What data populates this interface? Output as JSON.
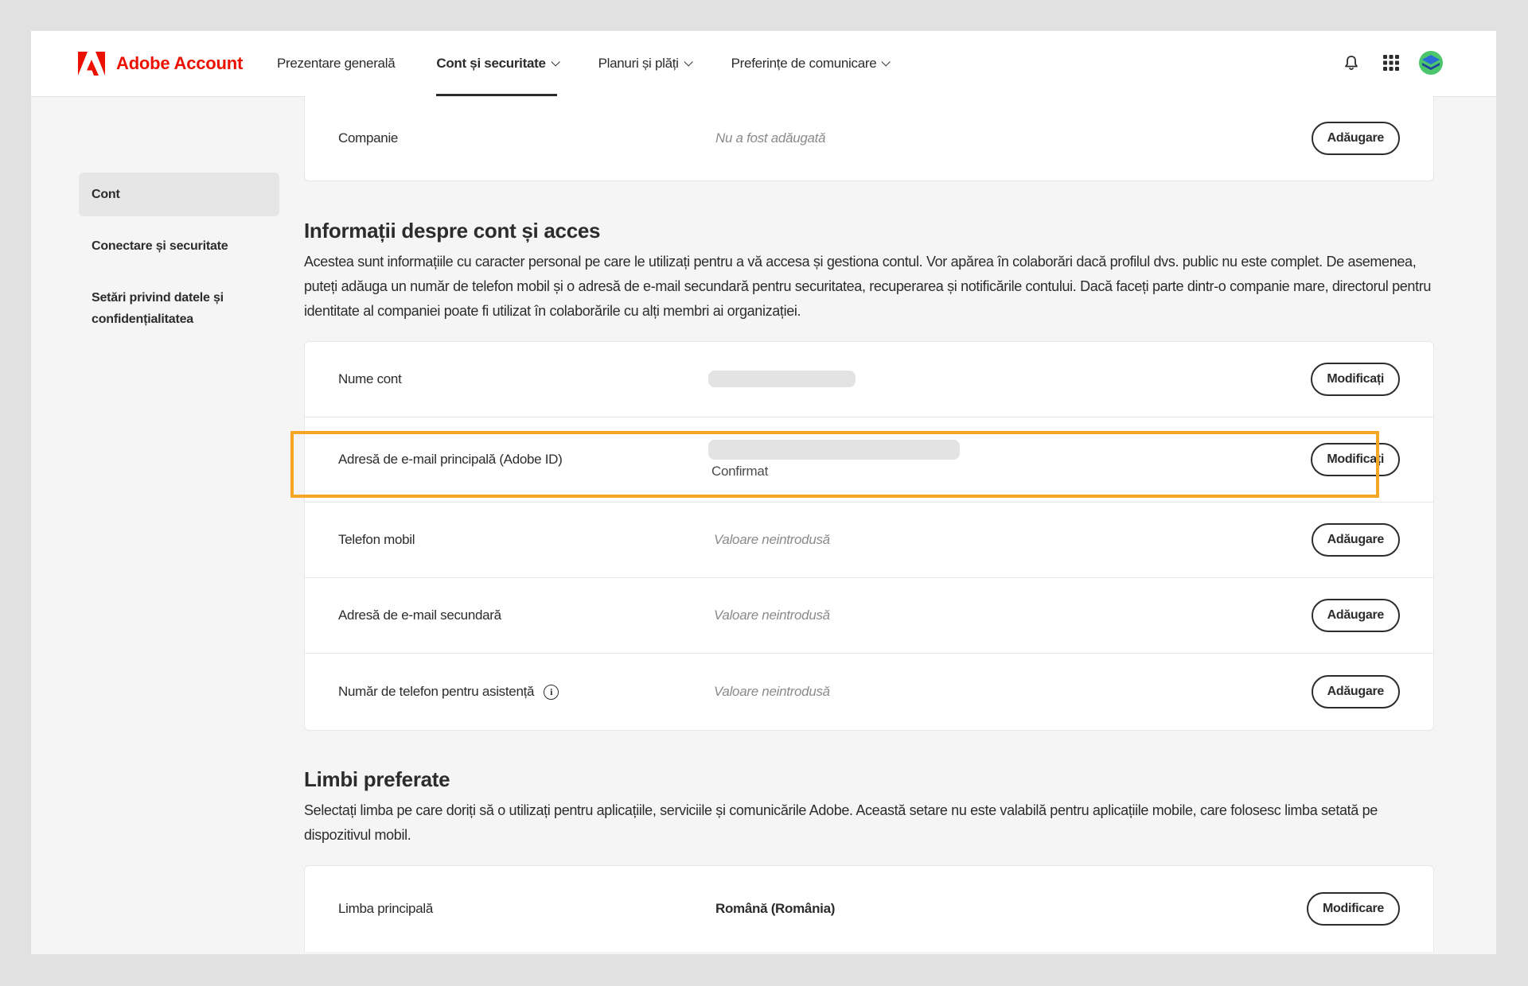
{
  "header": {
    "brand": "Adobe Account",
    "nav": [
      {
        "label": "Prezentare generală",
        "dropdown": false,
        "active": false
      },
      {
        "label": "Cont și securitate",
        "dropdown": true,
        "active": true
      },
      {
        "label": "Planuri și plăți",
        "dropdown": true,
        "active": false
      },
      {
        "label": "Preferințe de comunicare",
        "dropdown": true,
        "active": false
      }
    ],
    "icons": [
      "bell-icon",
      "app-grid-icon",
      "avatar"
    ]
  },
  "sidebar": {
    "items": [
      {
        "label": "Cont",
        "active": true
      },
      {
        "label": "Conectare și securitate",
        "active": false
      },
      {
        "label": "Setări privind datele și confidențialitatea",
        "active": false
      }
    ]
  },
  "company_row": {
    "label": "Companie",
    "value": "Nu a fost adăugată",
    "button": "Adăugare"
  },
  "account_section": {
    "title": "Informații despre cont și acces",
    "description": "Acestea sunt informațiile cu caracter personal pe care le utilizați pentru a vă accesa și gestiona contul. Vor apărea în colaborări dacă profilul dvs. public nu este complet. De asemenea, puteți adăuga un număr de telefon mobil și o adresă de e-mail secundară pentru securitatea, recuperarea și notificările contului. Dacă faceți parte dintr-o companie mare, directorul pentru identitate al companiei poate fi utilizat în colaborările cu alți membri ai organizației.",
    "rows": {
      "account_name": {
        "label": "Nume cont",
        "button": "Modificați"
      },
      "primary_email": {
        "label": "Adresă de e-mail principală (Adobe ID)",
        "status": "Confirmat",
        "button": "Modificați"
      },
      "mobile_phone": {
        "label": "Telefon mobil",
        "value": "Valoare neintrodusă",
        "button": "Adăugare"
      },
      "secondary_email": {
        "label": "Adresă de e-mail secundară",
        "value": "Valoare neintrodusă",
        "button": "Adăugare"
      },
      "support_phone": {
        "label": "Număr de telefon pentru asistență",
        "value": "Valoare neintrodusă",
        "button": "Adăugare"
      }
    }
  },
  "language_section": {
    "title": "Limbi preferate",
    "description": "Selectați limba pe care doriți să o utilizați pentru aplicațiile, serviciile și comunicările Adobe. Această setare nu este valabilă pentru aplicațiile mobile, care folosesc limba setată pe dispozitivul mobil.",
    "primary": {
      "label": "Limba principală",
      "value": "Română (România)",
      "button": "Modificare"
    }
  },
  "colors": {
    "brand": "#eb1000",
    "highlight": "#f5a623"
  }
}
